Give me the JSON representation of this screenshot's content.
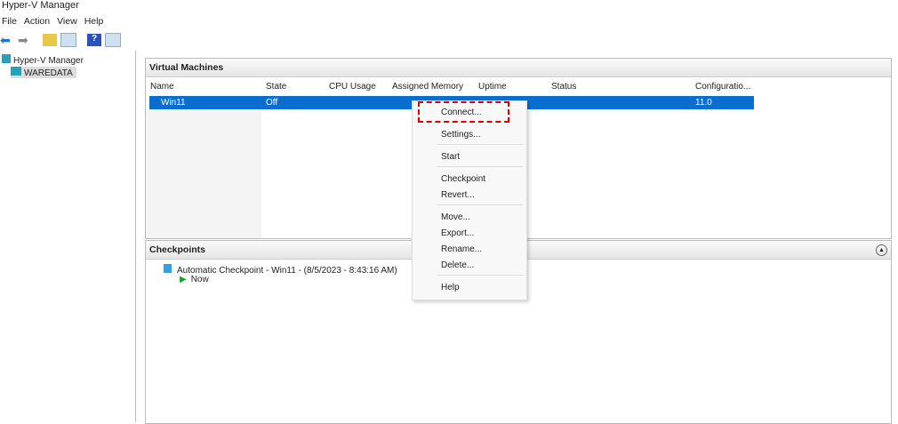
{
  "window_title": "Hyper-V Manager",
  "menu": [
    "File",
    "Action",
    "View",
    "Help"
  ],
  "tree": {
    "root": "Hyper-V Manager",
    "server": "WAREDATA"
  },
  "vm_panel": {
    "title": "Virtual Machines",
    "columns": [
      "Name",
      "State",
      "CPU Usage",
      "Assigned Memory",
      "Uptime",
      "Status",
      "Configuratio..."
    ],
    "rows": [
      {
        "name": "Win11",
        "state": "Off",
        "config": "11.0"
      }
    ]
  },
  "checkpoints": {
    "title": "Checkpoints",
    "items": [
      "Automatic Checkpoint - Win11 - (8/5/2023 - 8:43:16 AM)",
      "Now"
    ]
  },
  "context_menu": [
    "Connect...",
    "Settings...",
    "Start",
    "Checkpoint",
    "Revert...",
    "Move...",
    "Export...",
    "Rename...",
    "Delete...",
    "Help"
  ],
  "colors": {
    "selection": "#0a6ed1",
    "highlight": "#e00000"
  }
}
